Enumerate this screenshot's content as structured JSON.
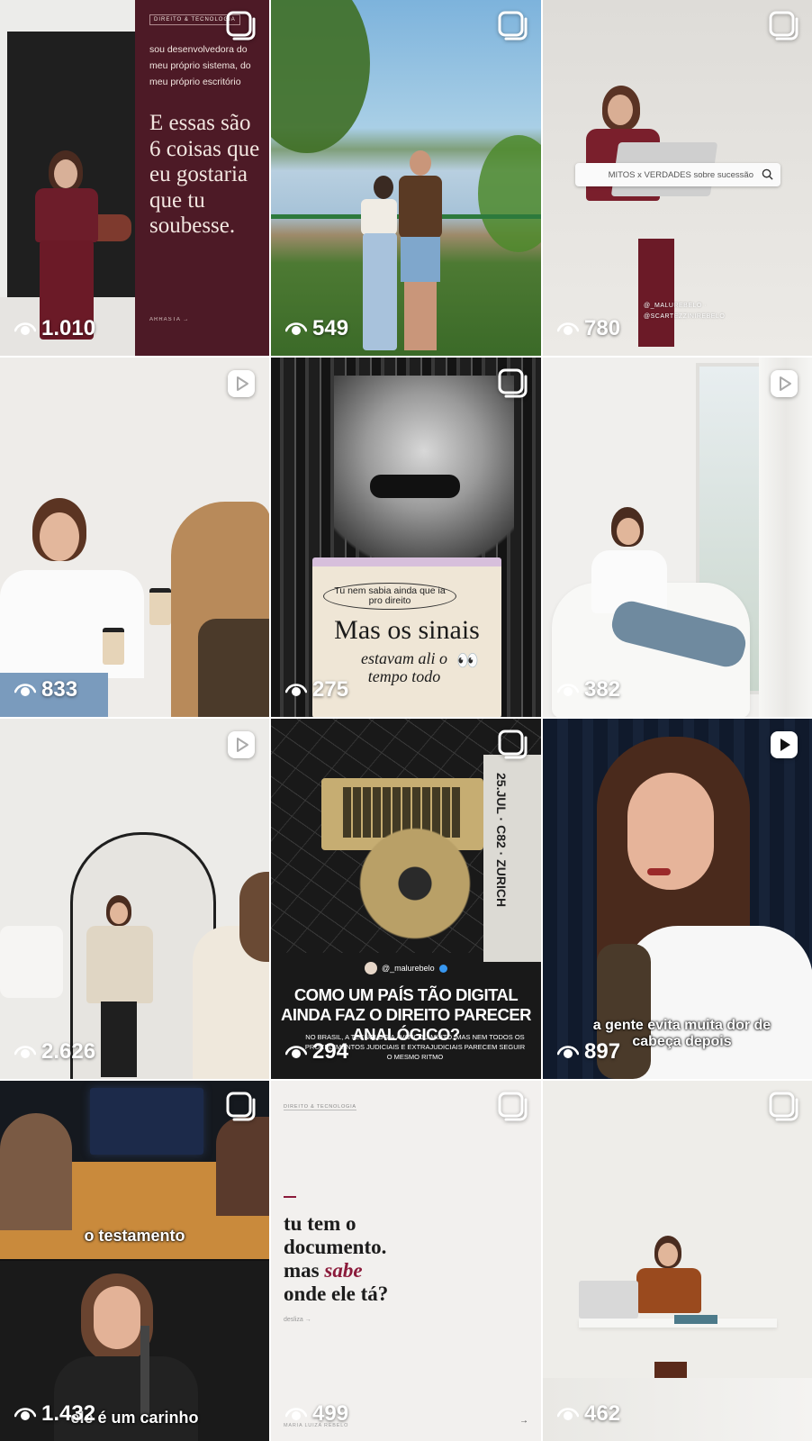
{
  "tiles": [
    {
      "views": "1.010",
      "badge": "carousel",
      "panel_tag": "DIREITO & TECNOLOGIA",
      "panel_intro": "sou desenvolvedora do meu próprio sistema, do meu próprio escritório",
      "panel_title": "E essas são 6 coisas que eu gostaria que tu soubesse.",
      "panel_footer": "ARRASTA →"
    },
    {
      "views": "549",
      "badge": "carousel"
    },
    {
      "views": "780",
      "badge": "carousel",
      "search_text": "MITOS x VERDADES sobre sucessão",
      "handles": "@_MALUREBELO · @SCARTEZZINIREBELO"
    },
    {
      "views": "833",
      "badge": "reel"
    },
    {
      "views": "275",
      "badge": "carousel",
      "bubble": "Tu nem sabia ainda que ia pro direito",
      "headline": "Mas os sinais",
      "subline": "estavam ali o tempo todo"
    },
    {
      "views": "382",
      "badge": "reel"
    },
    {
      "views": "2.626",
      "badge": "reel"
    },
    {
      "views": "294",
      "badge": "carousel",
      "handle": "@_malurebelo",
      "headline": "COMO UM PAÍS TÃO DIGITAL AINDA FAZ O DIREITO PARECER ANALÓGICO?",
      "body": "NO BRASIL, A TECNOLOGIA AVANÇOU MUITO. MAS NEM TODOS OS PROCEDIMENTOS JUDICIAIS E EXTRAJUDICIAIS PARECEM SEGUIR O MESMO RITMO",
      "ticket": "25.JUL · C82 · ZURICH"
    },
    {
      "views": "897",
      "badge": "reel",
      "caption": "a gente evita muita dor de cabeça depois"
    },
    {
      "views": "1.432",
      "badge": "carousel",
      "caption_top": "o testamento",
      "caption_bottom": "ele é um carinho"
    },
    {
      "views": "499",
      "badge": "carousel",
      "tag": "DIREITO & TECNOLOGIA",
      "line1": "tu tem o documento.",
      "line2_a": "mas ",
      "line2_b": "sabe",
      "line3": "onde ele tá?",
      "footer": "desliza →",
      "author": "MARIA LUIZA REBELO"
    },
    {
      "views": "462",
      "badge": "carousel"
    }
  ],
  "colors": {
    "burgundy": "#4d1a26",
    "accent": "#8b1a3a",
    "white": "#ffffff"
  }
}
